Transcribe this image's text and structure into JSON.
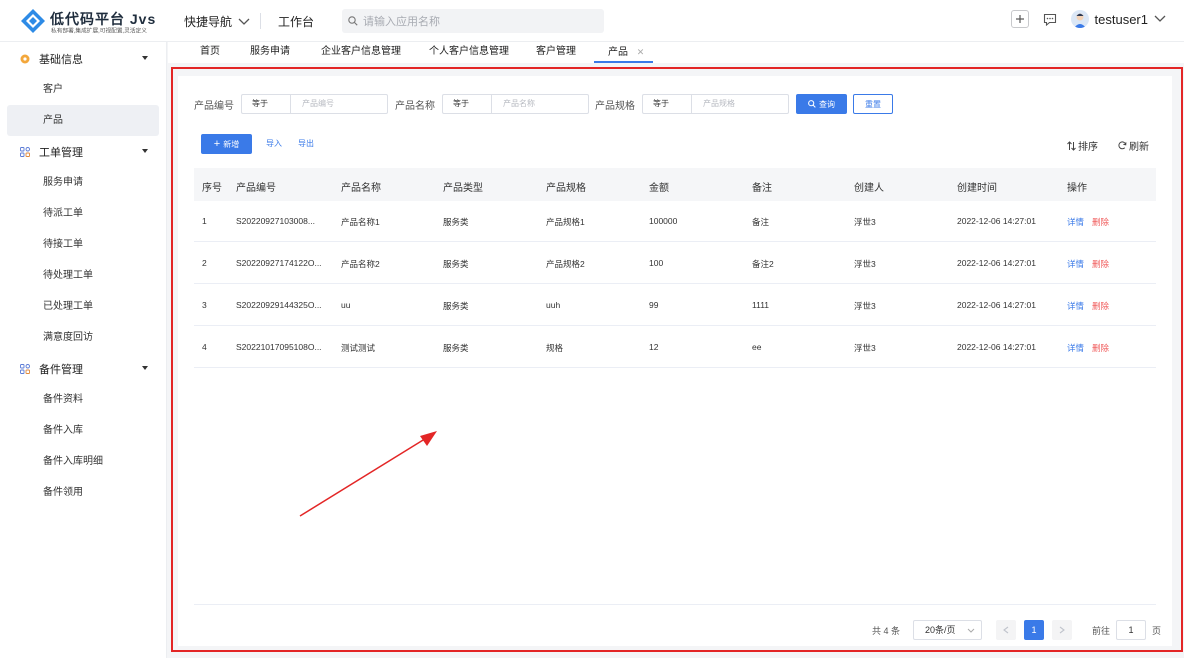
{
  "brand": {
    "title": "低代码平台 Jvs",
    "subtitle": "私有部署,集成扩展,可视配置,灵活定义"
  },
  "header": {
    "quick_nav": "快捷导航",
    "workbench": "工作台",
    "search_placeholder": "请输入应用名称",
    "username": "testuser1"
  },
  "sidebar": {
    "groups": [
      {
        "label": "基础信息",
        "items": [
          "客户",
          "产品"
        ]
      },
      {
        "label": "工单管理",
        "items": [
          "服务申请",
          "待派工单",
          "待接工单",
          "待处理工单",
          "已处理工单",
          "满意度回访"
        ]
      },
      {
        "label": "备件管理",
        "items": [
          "备件资料",
          "备件入库",
          "备件入库明细",
          "备件领用"
        ]
      }
    ],
    "active_item": "产品"
  },
  "tabs": [
    "首页",
    "服务申请",
    "企业客户信息管理",
    "个人客户信息管理",
    "客户管理",
    "产品"
  ],
  "filters": [
    {
      "label": "产品编号",
      "operator": "等于",
      "placeholder": "产品编号"
    },
    {
      "label": "产品名称",
      "operator": "等于",
      "placeholder": "产品名称"
    },
    {
      "label": "产品规格",
      "operator": "等于",
      "placeholder": "产品规格"
    }
  ],
  "buttons": {
    "query": "查询",
    "reset": "重置",
    "add": "新增",
    "import": "导入",
    "export": "导出",
    "sort": "排序",
    "refresh": "刷新"
  },
  "table": {
    "headers": [
      "序号",
      "产品编号",
      "产品名称",
      "产品类型",
      "产品规格",
      "金额",
      "备注",
      "创建人",
      "创建时间",
      "操作"
    ],
    "rows": [
      [
        "1",
        "S20220927103008...",
        "产品名称1",
        "服务类",
        "产品规格1",
        "100000",
        "备注",
        "浮世3",
        "2022-12-06 14:27:01"
      ],
      [
        "2",
        "S20220927174122O...",
        "产品名称2",
        "服务类",
        "产品规格2",
        "100",
        "备注2",
        "浮世3",
        "2022-12-06 14:27:01"
      ],
      [
        "3",
        "S20220929144325O...",
        "uu",
        "服务类",
        "uuh",
        "99",
        "1111",
        "浮世3",
        "2022-12-06 14:27:01"
      ],
      [
        "4",
        "S20221017095108O...",
        "测试测试",
        "服务类",
        "规格",
        "12",
        "ee",
        "浮世3",
        "2022-12-06 14:27:01"
      ]
    ],
    "ops": [
      "详情",
      "删除"
    ]
  },
  "pagination": {
    "total": "共 4 条",
    "page_size": "20条/页",
    "current": "1",
    "goto_label": "前往",
    "goto_value": "1",
    "page_unit": "页"
  },
  "colors": {
    "primary": "#3a7ae8",
    "danger": "#f05a5a",
    "annotation": "#e32626"
  }
}
